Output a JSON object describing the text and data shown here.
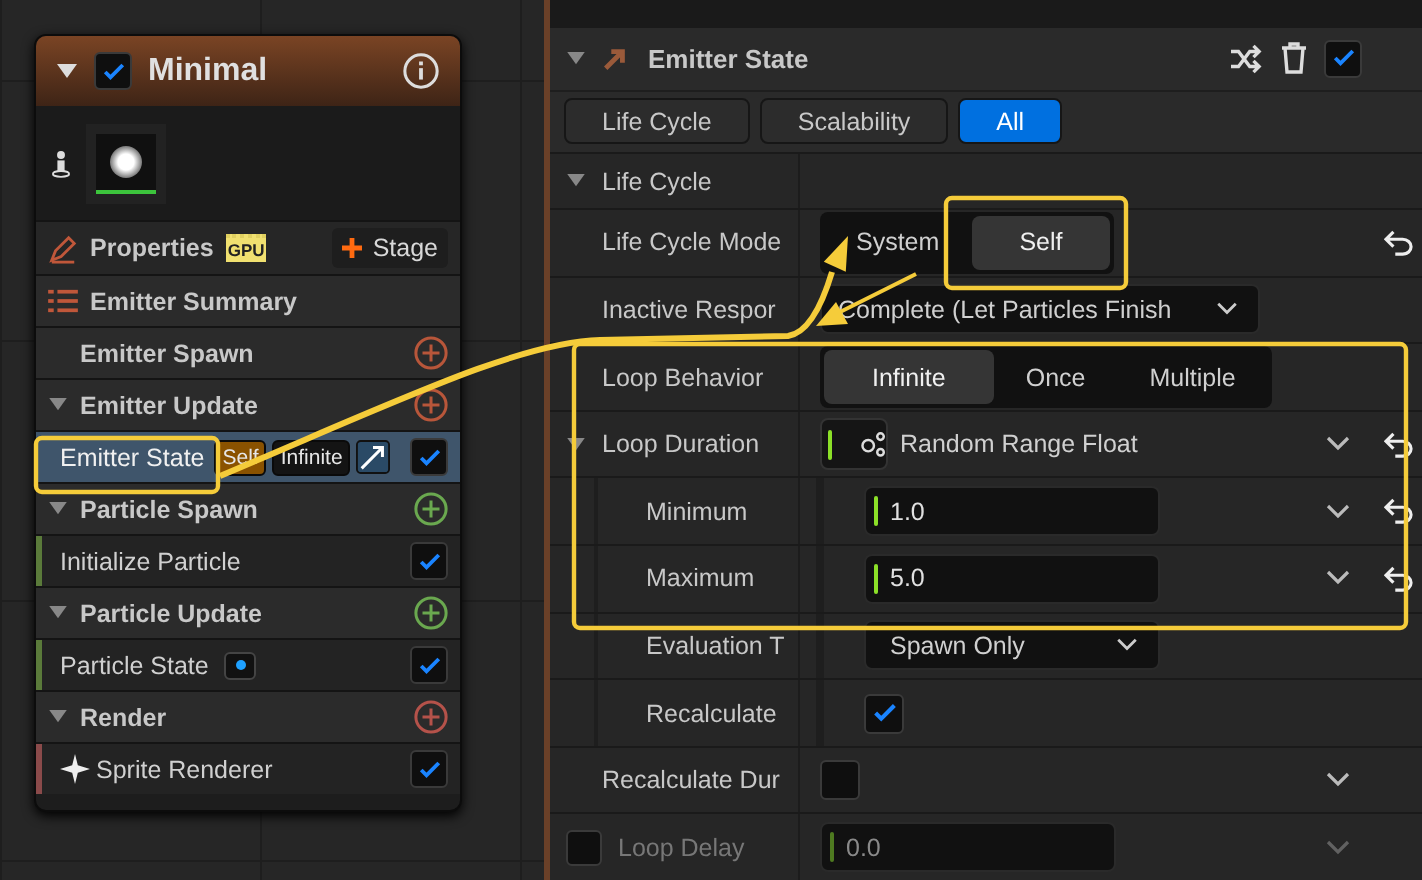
{
  "node": {
    "title": "Minimal",
    "enabled": true,
    "properties": "Properties",
    "gpu_badge": "GPU",
    "stage_button": "Stage",
    "items": [
      {
        "kind": "summary",
        "label": "Emitter Summary"
      },
      {
        "kind": "group",
        "label": "Emitter Spawn",
        "expanded": false,
        "color": "#b8563a"
      },
      {
        "kind": "group",
        "label": "Emitter Update",
        "expanded": true,
        "color": "#b8563a"
      },
      {
        "kind": "module",
        "label": "Emitter State",
        "selected": true,
        "checked": true,
        "badges": [
          {
            "text": "Self",
            "color": "#8a5200"
          },
          {
            "text": "Infinite",
            "color": "#141414"
          }
        ]
      },
      {
        "kind": "group",
        "label": "Particle Spawn",
        "expanded": true,
        "color": "#6aa84f"
      },
      {
        "kind": "module",
        "label": "Initialize Particle",
        "selected": false,
        "checked": true,
        "color": "#5a7a3a"
      },
      {
        "kind": "group",
        "label": "Particle Update",
        "expanded": true,
        "color": "#6aa84f"
      },
      {
        "kind": "module",
        "label": "Particle State",
        "selected": false,
        "checked": true,
        "color": "#5a7a3a"
      },
      {
        "kind": "group",
        "label": "Render",
        "expanded": true,
        "color": "#b5524a"
      },
      {
        "kind": "module",
        "label": "Sprite Renderer",
        "selected": false,
        "checked": true,
        "color": "#8a4a4a"
      }
    ]
  },
  "panel": {
    "title": "Emitter State",
    "enabled": true,
    "tabs": [
      {
        "label": "Life Cycle",
        "selected": false
      },
      {
        "label": "Scalability",
        "selected": false
      },
      {
        "label": "All",
        "selected": true
      }
    ],
    "section": {
      "label": "Life Cycle",
      "expanded": true
    },
    "rows": [
      {
        "kind": "segmented",
        "label": "Life Cycle Mode",
        "reset": true,
        "options": [
          {
            "label": "System",
            "selected": false
          },
          {
            "label": "Self",
            "selected": true
          }
        ]
      },
      {
        "kind": "dropdown",
        "label": "Inactive Respor",
        "value": "Complete (Let Particles Finish"
      },
      {
        "kind": "segmented",
        "label": "Loop Behavior",
        "options": [
          {
            "label": "Infinite",
            "selected": true
          },
          {
            "label": "Once",
            "selected": false
          },
          {
            "label": "Multiple",
            "selected": false
          }
        ]
      },
      {
        "kind": "function",
        "label": "Loop Duration",
        "value": "Random Range Float",
        "expanded": true,
        "reset": true,
        "chevron": true,
        "children": [
          {
            "kind": "number",
            "label": "Minimum",
            "value": "1.0",
            "reset": true,
            "chevron": true
          },
          {
            "kind": "number",
            "label": "Maximum",
            "value": "5.0",
            "reset": true,
            "chevron": true
          },
          {
            "kind": "dropdown",
            "label": "Evaluation T",
            "value": "Spawn Only"
          },
          {
            "kind": "checkbox",
            "label": "Recalculate",
            "checked": true
          }
        ]
      },
      {
        "kind": "checkbox",
        "label": "Recalculate Dur",
        "checked": false,
        "chevron": true
      },
      {
        "kind": "number",
        "label": "Loop Delay",
        "value": "0.0",
        "disabled": true,
        "checked": false,
        "chevron": true
      }
    ]
  }
}
